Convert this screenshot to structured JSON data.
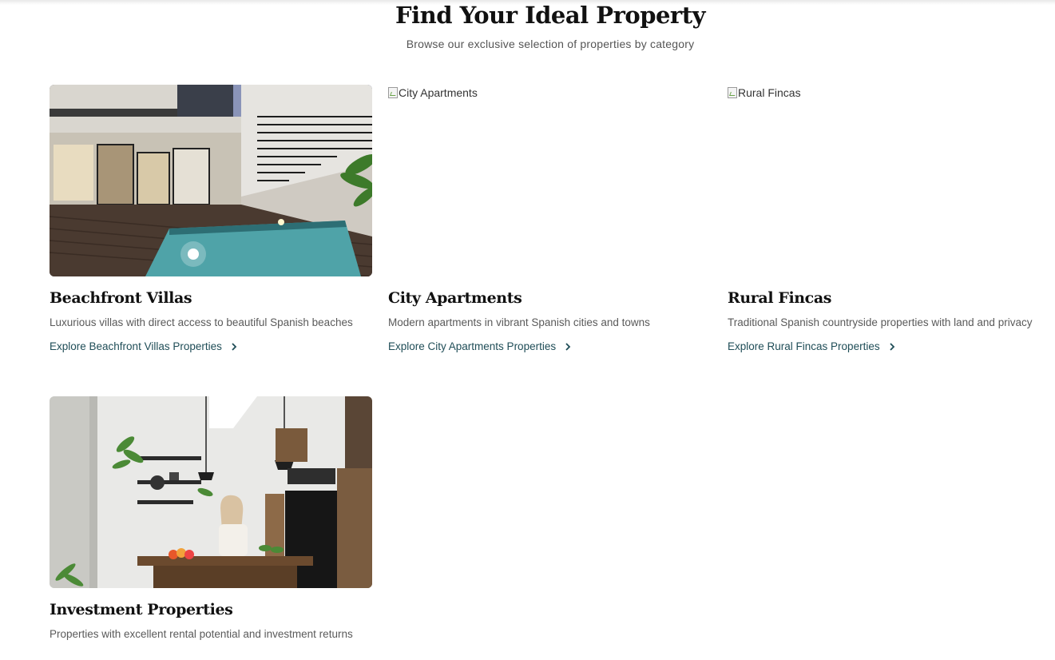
{
  "header": {
    "title": "Find Your Ideal Property",
    "subtitle": "Browse our exclusive selection of properties by category"
  },
  "categories": [
    {
      "title": "Beachfront Villas",
      "description": "Luxurious villas with direct access to beautiful Spanish beaches",
      "link_label": "Explore Beachfront Villas Properties",
      "image_alt": "Beachfront Villas",
      "image_loaded": true
    },
    {
      "title": "City Apartments",
      "description": "Modern apartments in vibrant Spanish cities and towns",
      "link_label": "Explore City Apartments Properties",
      "image_alt": "City Apartments",
      "image_loaded": false
    },
    {
      "title": "Rural Fincas",
      "description": "Traditional Spanish countryside properties with land and privacy",
      "link_label": "Explore Rural Fincas Properties",
      "image_alt": "Rural Fincas",
      "image_loaded": false
    },
    {
      "title": "Investment Properties",
      "description": "Properties with excellent rental potential and investment returns",
      "image_alt": "Investment Properties",
      "image_loaded": true
    }
  ],
  "icons": {
    "link_arrow": "chevron-right-icon",
    "broken_image": "broken-image-icon"
  },
  "colors": {
    "link": "#1f4d57",
    "heading": "#111111",
    "body_text": "#5a5a5a"
  }
}
